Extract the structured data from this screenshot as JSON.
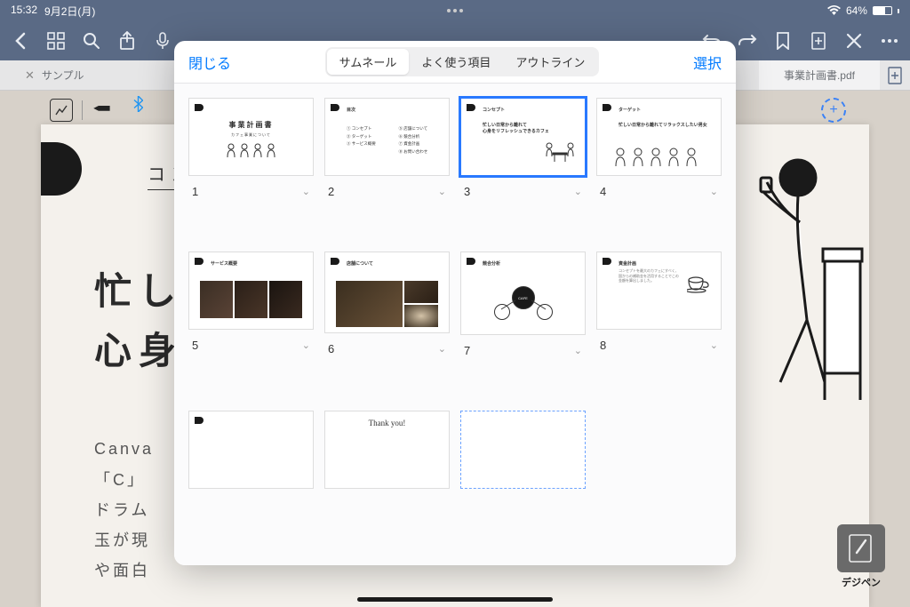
{
  "status": {
    "time": "15:32",
    "date": "9月2日(月)",
    "battery": "64%"
  },
  "tabs": {
    "tab1": "サンプル",
    "tab2": "事業計画書.pdf"
  },
  "popover": {
    "close": "閉じる",
    "select": "選択",
    "segments": {
      "thumbnails": "サムネール",
      "frequent": "よく使う項目",
      "outline": "アウトライン"
    },
    "pages": {
      "p1": "1",
      "p2": "2",
      "p3": "3",
      "p4": "4",
      "p5": "5",
      "p6": "6",
      "p7": "7",
      "p8": "8"
    },
    "slides": {
      "s1": {
        "title": "事業計画書",
        "subtitle": "カフェ事業について"
      },
      "s2": {
        "h": "目次",
        "l1": "コンセプト",
        "l2": "ターゲット",
        "l3": "サービス概要",
        "r1": "店舗について",
        "r2": "競合分析",
        "r3": "資金計画",
        "r4": "お問い合わせ"
      },
      "s3": {
        "h": "コンセプト",
        "t1": "忙しい日常から離れて",
        "t2": "心身をリフレッシュできるカフェ"
      },
      "s4": {
        "h": "ターゲット",
        "t1": "忙しい日常から離れてリラックスしたい男女"
      },
      "s5": {
        "h": "サービス概要"
      },
      "s6": {
        "h": "店舗について"
      },
      "s7": {
        "h": "競合分析"
      },
      "s8": {
        "h": "資金計画",
        "body": "コンセプトを最大のカフェにすべく、国からの補助金を活用することでこの金額を算出しました。"
      },
      "s10": {
        "thanks": "Thank you!"
      }
    }
  },
  "doc": {
    "label": "コンセ",
    "h1a": "忙し",
    "h1b": "心身",
    "body1": "Canva",
    "body2": "「C」",
    "body3": "ドラム",
    "body4": "玉が現",
    "body5": "や面白"
  },
  "brand": "デジペン"
}
